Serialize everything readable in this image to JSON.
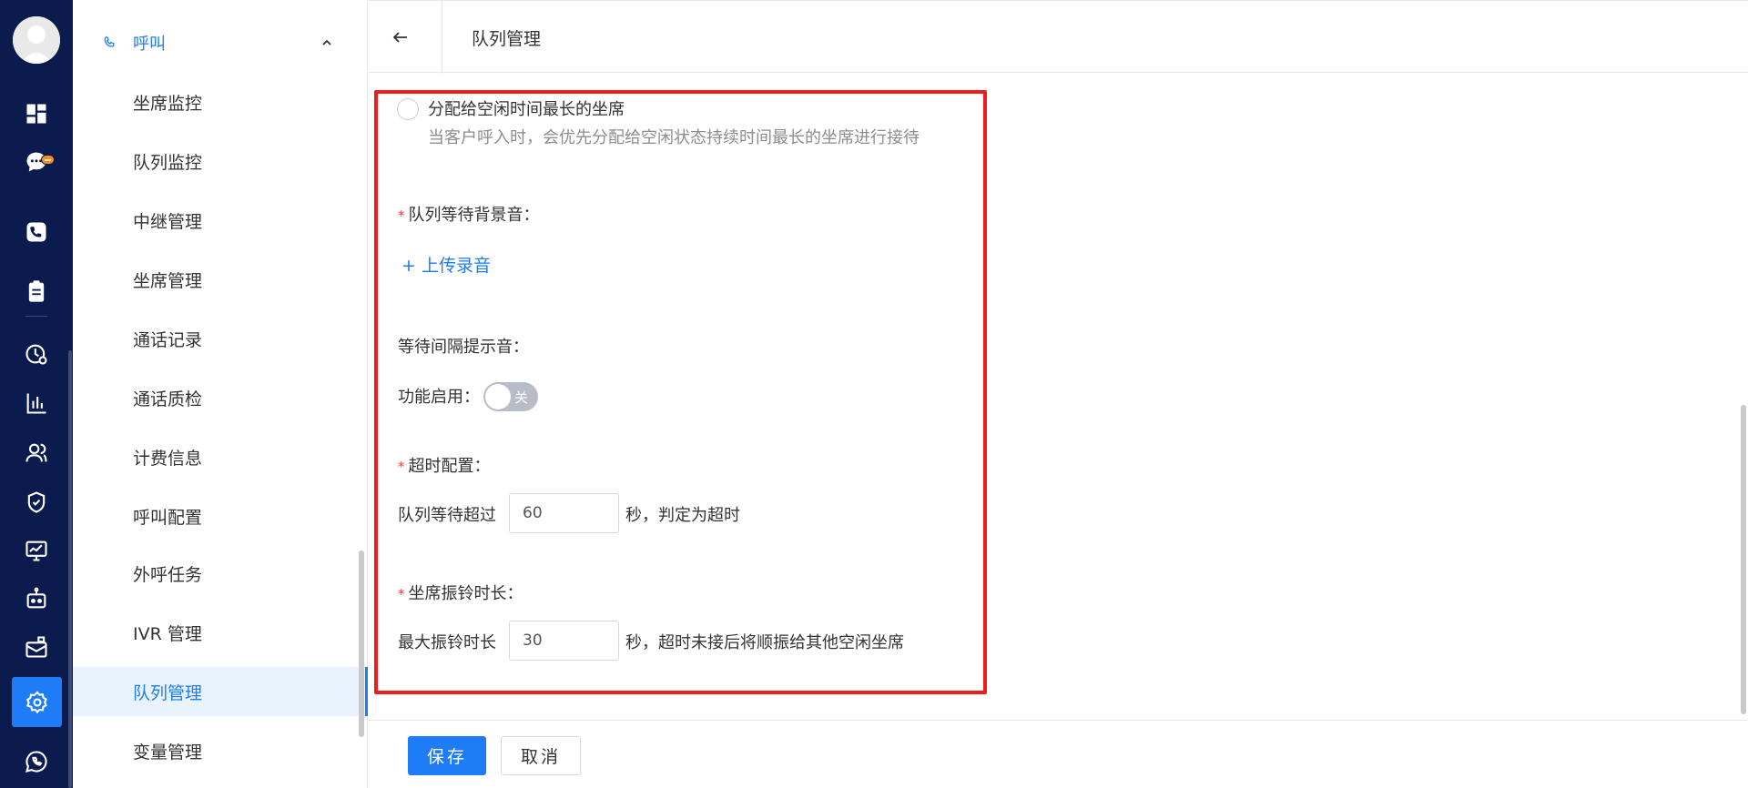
{
  "menu": {
    "group_label": "呼叫",
    "items": [
      {
        "label": "坐席监控"
      },
      {
        "label": "队列监控"
      },
      {
        "label": "中继管理"
      },
      {
        "label": "坐席管理"
      },
      {
        "label": "通话记录"
      },
      {
        "label": "通话质检"
      },
      {
        "label": "计费信息"
      },
      {
        "label": "呼叫配置"
      },
      {
        "label": "外呼任务"
      },
      {
        "label": "IVR 管理"
      },
      {
        "label": "队列管理"
      },
      {
        "label": "变量管理"
      }
    ],
    "active_item": "队列管理"
  },
  "header": {
    "title": "队列管理"
  },
  "form": {
    "option": {
      "title": "分配给空闲时间最长的坐席",
      "description": "当客户呼入时，会优先分配给空闲状态持续时间最长的坐席进行接待"
    },
    "bg_music_label": "队列等待背景音：",
    "upload_label": "+ 上传录音",
    "interval_tone_label": "等待间隔提示音：",
    "feature_enable_label": "功能启用：",
    "toggle_text": "关",
    "timeout_label": "超时配置：",
    "timeout_prefix": "队列等待超过",
    "timeout_value": "60",
    "timeout_suffix": "秒，判定为超时",
    "ring_label": "坐席振铃时长：",
    "ring_prefix": "最大振铃时长",
    "ring_value": "30",
    "ring_suffix": "秒，超时未接后将顺振给其他空闲坐席"
  },
  "footer": {
    "save_label": "保存",
    "cancel_label": "取消"
  },
  "colors": {
    "rail_bg": "#0c1b4d",
    "accent": "#1e7cf6",
    "highlight_border": "#ee1c1c",
    "badge": "#ff8a1f"
  },
  "icons": {
    "rail": [
      "dashboard-icon",
      "chat-icon",
      "phone-icon",
      "clipboard-icon",
      "clock-chart-icon",
      "bar-chart-icon",
      "users-icon",
      "shield-icon",
      "monitor-icon",
      "robot-icon",
      "mailbox-icon",
      "settings-icon",
      "whatsapp-icon"
    ]
  }
}
